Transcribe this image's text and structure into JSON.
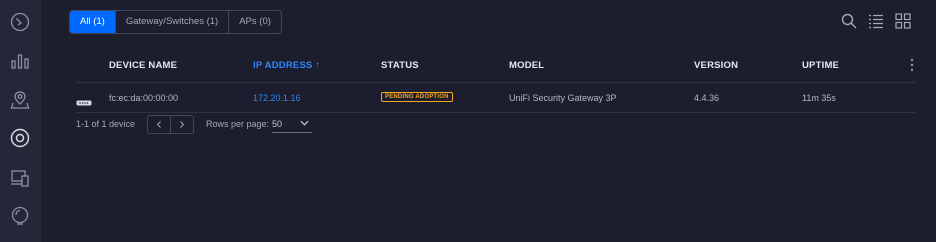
{
  "filters": {
    "all": "All (1)",
    "gateway_switches": "Gateway/Switches (1)",
    "aps": "APs (0)"
  },
  "table": {
    "columns": {
      "device_name": "DEVICE NAME",
      "ip_address": "IP ADDRESS ↑",
      "status": "STATUS",
      "model": "MODEL",
      "version": "VERSION",
      "uptime": "UPTIME"
    },
    "rows": [
      {
        "device_name": "fc:ec:da:00:00:00",
        "ip_address": "172.20.1.16",
        "status": "PENDING ADOPTION",
        "model": "UniFi Security Gateway 3P",
        "version": "4.4.36",
        "uptime": "11m 35s"
      }
    ]
  },
  "footer": {
    "count": "1-1 of 1 device",
    "rows_per_page_label": "Rows per page:",
    "rows_per_page_value": "50"
  },
  "colors": {
    "background": "#1c1e2d",
    "sidebar": "#242738",
    "accent": "#0069ff",
    "link": "#2f86ff",
    "pending": "#f5a623"
  },
  "icons": {
    "sidebar": [
      "dashboard-icon",
      "statistics-icon",
      "map-icon",
      "devices-icon",
      "clients-icon",
      "insights-icon"
    ],
    "toolbar": [
      "search-icon",
      "list-view-icon",
      "grid-view-icon"
    ]
  }
}
